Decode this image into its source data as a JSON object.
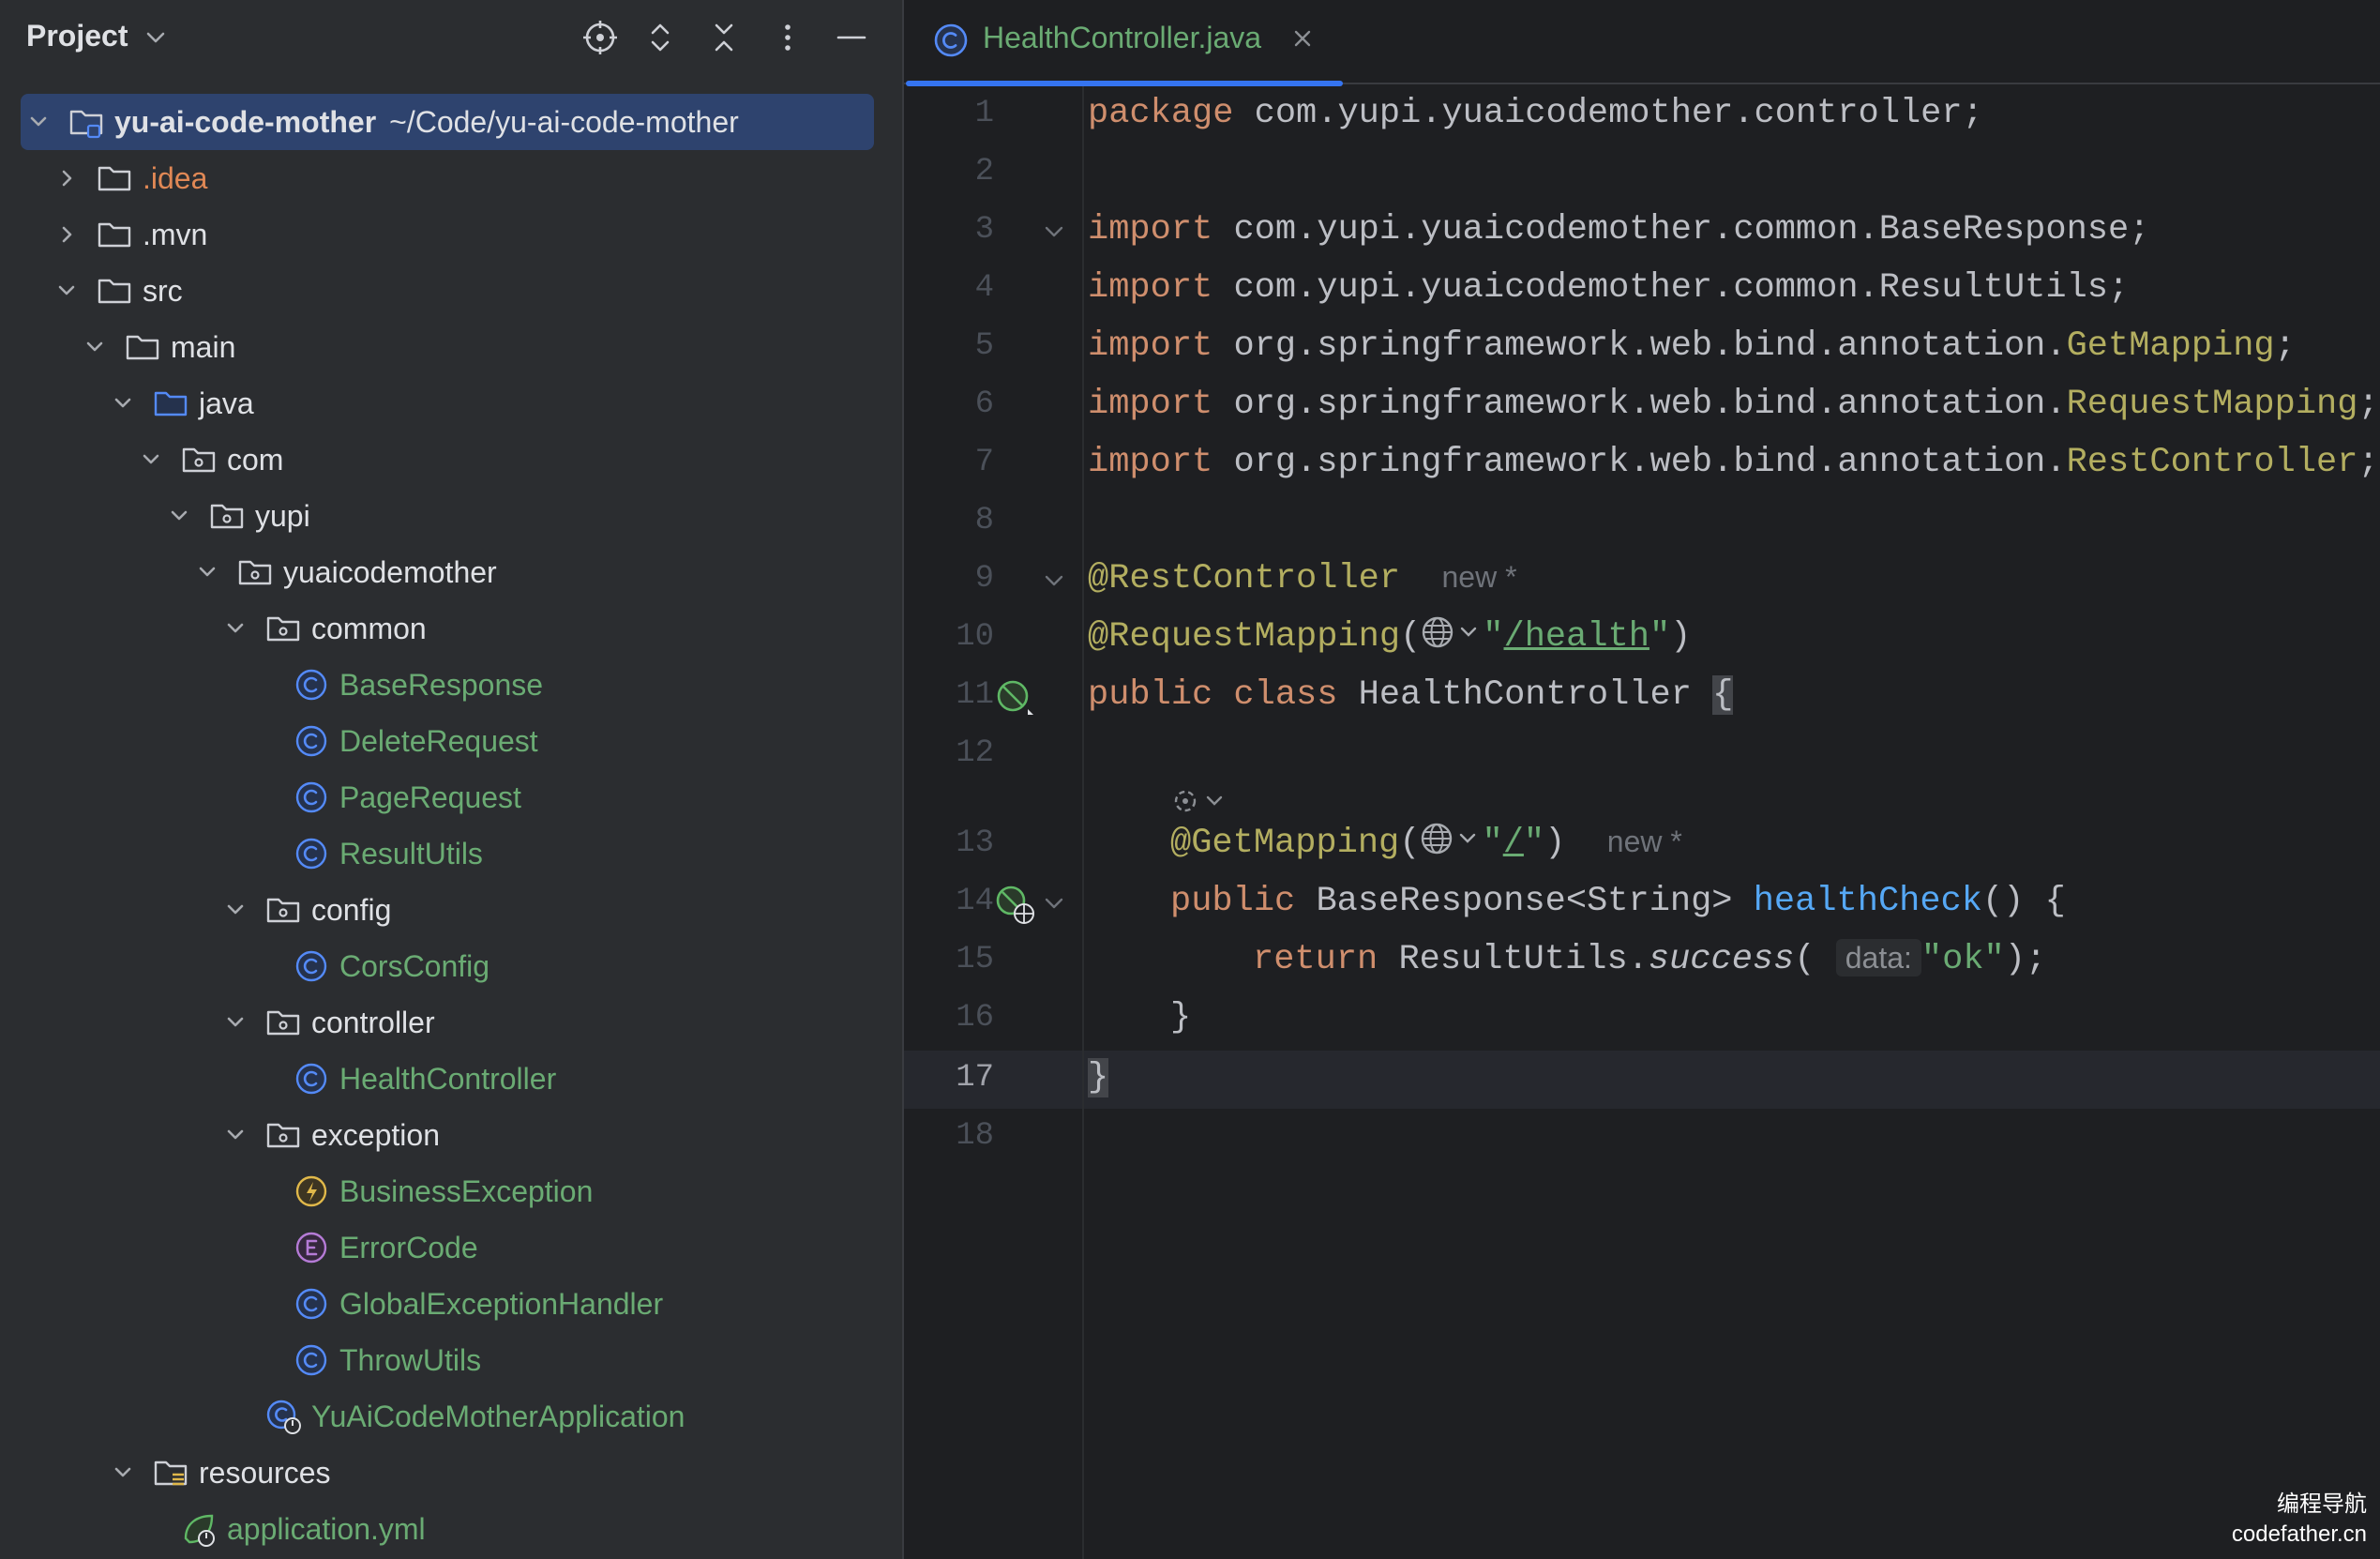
{
  "panel": {
    "title": "Project",
    "header_icons": [
      "locate-icon",
      "expand-all-icon",
      "collapse-all-icon",
      "more-icon",
      "minimize-icon"
    ]
  },
  "tree": [
    {
      "label": "yu-ai-code-mother",
      "path": "~/Code/yu-ai-code-mother",
      "depth": 0,
      "chevron": "down",
      "icon": "module-folder",
      "selected": true,
      "bold": true
    },
    {
      "label": ".idea",
      "depth": 1,
      "chevron": "right",
      "icon": "folder",
      "color": "orange"
    },
    {
      "label": ".mvn",
      "depth": 1,
      "chevron": "right",
      "icon": "folder"
    },
    {
      "label": "src",
      "depth": 1,
      "chevron": "down",
      "icon": "folder"
    },
    {
      "label": "main",
      "depth": 2,
      "chevron": "down",
      "icon": "folder"
    },
    {
      "label": "java",
      "depth": 3,
      "chevron": "down",
      "icon": "source-folder"
    },
    {
      "label": "com",
      "depth": 4,
      "chevron": "down",
      "icon": "package"
    },
    {
      "label": "yupi",
      "depth": 5,
      "chevron": "down",
      "icon": "package"
    },
    {
      "label": "yuaicodemother",
      "depth": 6,
      "chevron": "down",
      "icon": "package"
    },
    {
      "label": "common",
      "depth": 7,
      "chevron": "down",
      "icon": "package"
    },
    {
      "label": "BaseResponse",
      "depth": 8,
      "icon": "class",
      "color": "green"
    },
    {
      "label": "DeleteRequest",
      "depth": 8,
      "icon": "class",
      "color": "green"
    },
    {
      "label": "PageRequest",
      "depth": 8,
      "icon": "class",
      "color": "green"
    },
    {
      "label": "ResultUtils",
      "depth": 8,
      "icon": "class",
      "color": "green"
    },
    {
      "label": "config",
      "depth": 7,
      "chevron": "down",
      "icon": "package"
    },
    {
      "label": "CorsConfig",
      "depth": 8,
      "icon": "class",
      "color": "green"
    },
    {
      "label": "controller",
      "depth": 7,
      "chevron": "down",
      "icon": "package"
    },
    {
      "label": "HealthController",
      "depth": 8,
      "icon": "class",
      "color": "green"
    },
    {
      "label": "exception",
      "depth": 7,
      "chevron": "down",
      "icon": "package"
    },
    {
      "label": "BusinessException",
      "depth": 8,
      "icon": "exception",
      "color": "green"
    },
    {
      "label": "ErrorCode",
      "depth": 8,
      "icon": "enum",
      "color": "green"
    },
    {
      "label": "GlobalExceptionHandler",
      "depth": 8,
      "icon": "class",
      "color": "green"
    },
    {
      "label": "ThrowUtils",
      "depth": 8,
      "icon": "class",
      "color": "green"
    },
    {
      "label": "YuAiCodeMotherApplication",
      "depth": 7,
      "icon": "spring-app",
      "color": "green"
    },
    {
      "label": "resources",
      "depth": 3,
      "chevron": "down",
      "icon": "resources-folder"
    },
    {
      "label": "application.yml",
      "depth": 4,
      "icon": "spring-config",
      "color": "green"
    }
  ],
  "editor": {
    "tab": {
      "label": "HealthController.java",
      "icon": "class-icon",
      "close_icon": "close-icon"
    },
    "current_line": 17,
    "line_numbers": [
      "1",
      "2",
      "3",
      "4",
      "5",
      "6",
      "7",
      "8",
      "9",
      "10",
      "11",
      "12",
      "13",
      "14",
      "15",
      "16",
      "17",
      "18"
    ],
    "code": {
      "l1_kw": "package",
      "l1_rest": " com.yupi.yuaicodemother.controller;",
      "l3_kw": "import",
      "l3_rest": " com.yupi.yuaicodemother.common.BaseResponse;",
      "l4_kw": "import",
      "l4_rest": " com.yupi.yuaicodemother.common.ResultUtils;",
      "l5_kw": "import",
      "l5_pre": " org.springframework.web.bind.annotation.",
      "l5_ann": "GetMapping",
      "l5_end": ";",
      "l6_kw": "import",
      "l6_pre": " org.springframework.web.bind.annotation.",
      "l6_ann": "RequestMapping",
      "l6_end": ";",
      "l7_kw": "import",
      "l7_pre": " org.springframework.web.bind.annotation.",
      "l7_ann": "RestController",
      "l7_end": ";",
      "l9_ann": "@RestController",
      "l9_hint": "new *",
      "l10_ann": "@RequestMapping",
      "l10_open": "(",
      "l10_q1": "\"",
      "l10_path": "/health",
      "l10_q2": "\"",
      "l10_close": ")",
      "l11_kw": "public class",
      "l11_name": " HealthController ",
      "l11_brace": "{",
      "l13_ann": "@GetMapping",
      "l13_open": "(",
      "l13_q1": "\"",
      "l13_path": "/",
      "l13_q2": "\"",
      "l13_close": ")",
      "l13_hint": "new *",
      "l14_kw": "public",
      "l14_type": " BaseResponse<String> ",
      "l14_fn": "healthCheck",
      "l14_end": "() {",
      "l15_kw": "return",
      "l15_cls": " ResultUtils.",
      "l15_fn": "success",
      "l15_open": "( ",
      "l15_hint": "data:",
      "l15_str": "\"ok\"",
      "l15_end": ");",
      "l16": "}",
      "l17": "}"
    }
  },
  "watermark": {
    "line1": "编程导航",
    "line2": "codefather.cn"
  },
  "colors": {
    "panel_bg": "#2b2d30",
    "editor_bg": "#1e1f22",
    "selection": "#2e436e",
    "keyword": "#cf8e6d",
    "annotation": "#b3ae60",
    "string": "#6aab73",
    "function": "#56a8f5",
    "accent": "#3574f0"
  }
}
